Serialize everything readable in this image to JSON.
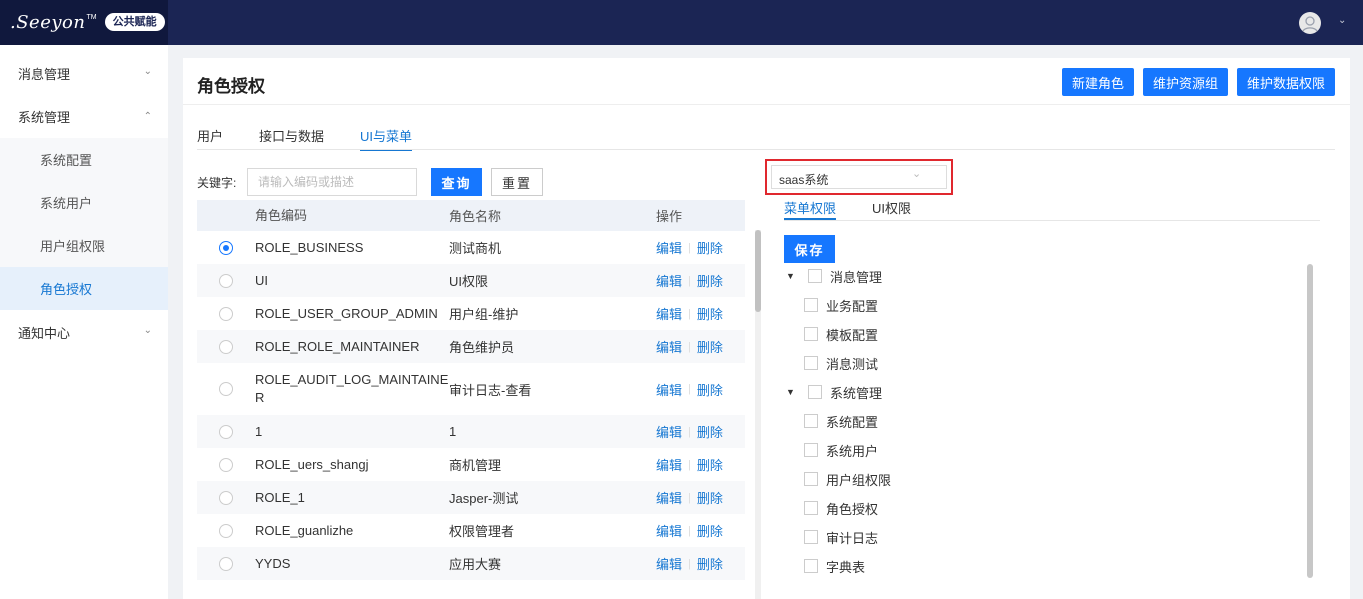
{
  "brand": {
    "logo_text": ".Seeyon",
    "tm": "TM",
    "badge": "公共赋能"
  },
  "sidebar": {
    "items": [
      {
        "label": "消息管理"
      },
      {
        "label": "系统管理"
      },
      {
        "label": "通知中心"
      }
    ],
    "sub_items": [
      {
        "label": "系统配置"
      },
      {
        "label": "系统用户"
      },
      {
        "label": "用户组权限"
      },
      {
        "label": "角色授权"
      }
    ]
  },
  "page": {
    "title": "角色授权",
    "actions": [
      "新建角色",
      "维护资源组",
      "维护数据权限"
    ]
  },
  "tabs": [
    "用户",
    "接口与数据",
    "UI与菜单"
  ],
  "search": {
    "label": "关键字:",
    "placeholder": "请输入编码或描述",
    "query_label": "查询",
    "reset_label": "重置"
  },
  "table": {
    "headers": [
      "角色编码",
      "角色名称",
      "操作"
    ],
    "edit_label": "编辑",
    "delete_label": "删除",
    "rows": [
      {
        "code": "ROLE_BUSINESS",
        "name": "测试商机"
      },
      {
        "code": "UI",
        "name": "UI权限"
      },
      {
        "code": "ROLE_USER_GROUP_ADMIN",
        "name": "用户组-维护"
      },
      {
        "code": "ROLE_ROLE_MAINTAINER",
        "name": "角色维护员"
      },
      {
        "code": "ROLE_AUDIT_LOG_MAINTAINE R",
        "name": "审计日志-查看"
      },
      {
        "code": "1",
        "name": "1"
      },
      {
        "code": "ROLE_uers_shangj",
        "name": "商机管理"
      },
      {
        "code": "ROLE_1",
        "name": "Jasper-测试"
      },
      {
        "code": "ROLE_guanlizhe",
        "name": "权限管理者"
      },
      {
        "code": "YYDS",
        "name": "应用大赛"
      }
    ]
  },
  "system_select": {
    "value": "saas系统"
  },
  "right_tabs": [
    "菜单权限",
    "UI权限"
  ],
  "save_label": "保存",
  "tree": {
    "groups": [
      {
        "label": "消息管理",
        "children": [
          "业务配置",
          "模板配置",
          "消息测试"
        ]
      },
      {
        "label": "系统管理",
        "children": [
          "系统配置",
          "系统用户",
          "用户组权限",
          "角色授权",
          "审计日志",
          "字典表"
        ]
      }
    ]
  },
  "colors": {
    "accent": "#1677ff",
    "topbar": "#1b2554",
    "highlight_border": "#e0282e"
  }
}
